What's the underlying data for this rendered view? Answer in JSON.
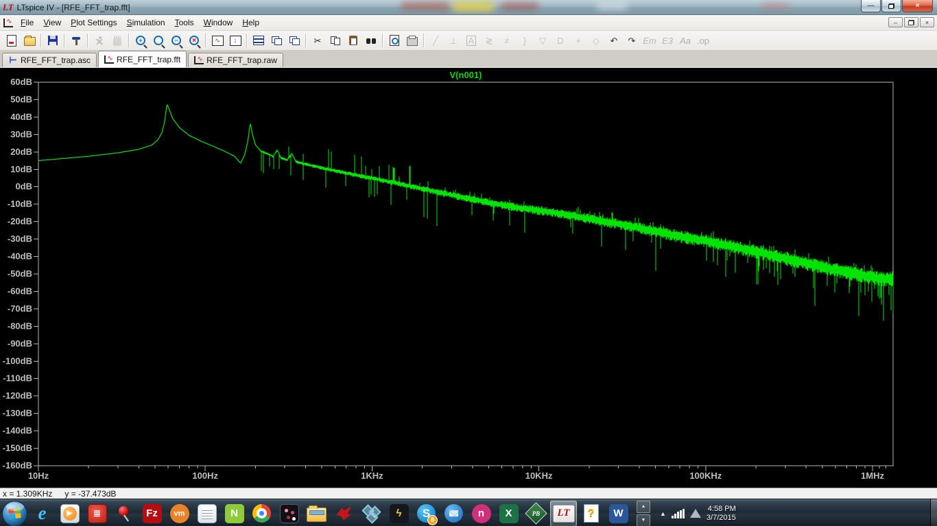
{
  "window": {
    "title": "LTspice IV - [RFE_FFT_trap.fft]",
    "app_icon": "LT",
    "controls": [
      "minimize",
      "restore",
      "close"
    ]
  },
  "menu": {
    "items": [
      "File",
      "View",
      "Plot Settings",
      "Simulation",
      "Tools",
      "Window",
      "Help"
    ],
    "child_controls": [
      "minimize",
      "restore",
      "close"
    ]
  },
  "toolbar": {
    "buttons": [
      {
        "name": "new-schematic-button",
        "icon": "doc",
        "enabled": true
      },
      {
        "name": "open-button",
        "icon": "folder",
        "enabled": true
      },
      {
        "sep": true
      },
      {
        "name": "save-button",
        "icon": "floppy",
        "enabled": true
      },
      {
        "sep": true
      },
      {
        "name": "control-panel-button",
        "icon": "hammer",
        "enabled": true
      },
      {
        "sep": true
      },
      {
        "name": "run-button",
        "icon": "run",
        "enabled": false
      },
      {
        "name": "halt-button",
        "icon": "hand",
        "enabled": false
      },
      {
        "sep": true
      },
      {
        "name": "zoom-in-button",
        "icon": "mag",
        "glyph": "+",
        "enabled": true
      },
      {
        "name": "zoom-window-button",
        "icon": "mag",
        "glyph": "",
        "enabled": true
      },
      {
        "name": "zoom-out-button",
        "icon": "mag",
        "glyph": "−",
        "enabled": true
      },
      {
        "name": "zoom-full-extents-button",
        "icon": "mag",
        "glyph": "×",
        "red": true,
        "enabled": true
      },
      {
        "sep": true
      },
      {
        "name": "autorange-y-button",
        "icon": "wavebox",
        "glyph": "∿",
        "enabled": true
      },
      {
        "name": "pan-zoom-button",
        "icon": "panzoom",
        "glyph": "↕",
        "enabled": true
      },
      {
        "sep": true
      },
      {
        "name": "tile-horizontal-button",
        "icon": "tileh",
        "enabled": true
      },
      {
        "name": "cascade-button",
        "icon": "casc",
        "enabled": true
      },
      {
        "name": "arrange-windows-button",
        "icon": "casc",
        "enabled": true
      },
      {
        "sep": true
      },
      {
        "name": "cut-button",
        "glyph": "✂",
        "color": "#222",
        "enabled": true
      },
      {
        "name": "copy-button",
        "icon": "copy",
        "enabled": true
      },
      {
        "name": "paste-button",
        "icon": "paste",
        "enabled": true
      },
      {
        "name": "find-button",
        "icon": "binoc",
        "enabled": true
      },
      {
        "sep": true
      },
      {
        "name": "print-preview-button",
        "icon": "preview",
        "enabled": true
      },
      {
        "name": "print-button",
        "icon": "printer",
        "enabled": true
      },
      {
        "sep": true
      },
      {
        "name": "draw-wire-button",
        "glyph": "╱",
        "color": "#8a8f94",
        "enabled": false
      },
      {
        "name": "place-ground-button",
        "glyph": "⊥",
        "color": "#8a8f94",
        "enabled": false
      },
      {
        "name": "place-label-button",
        "glyph": "A",
        "boxed": true,
        "color": "#8a8f94",
        "enabled": false
      },
      {
        "name": "place-resistor-button",
        "glyph": "≷",
        "color": "#8a8f94",
        "enabled": false
      },
      {
        "name": "place-capacitor-button",
        "glyph": "≠",
        "color": "#8a8f94",
        "enabled": false
      },
      {
        "name": "place-inductor-button",
        "glyph": "}",
        "color": "#8a8f94",
        "enabled": false
      },
      {
        "name": "place-diode-button",
        "glyph": "▽",
        "color": "#8a8f94",
        "enabled": false
      },
      {
        "name": "place-component-button",
        "glyph": "D",
        "color": "#8a8f94",
        "enabled": false
      },
      {
        "name": "move-button",
        "glyph": "+",
        "color": "#8a8f94",
        "enabled": false
      },
      {
        "name": "drag-button",
        "glyph": "◇",
        "color": "#8a8f94",
        "enabled": false
      },
      {
        "name": "undo-button",
        "glyph": "↶",
        "color": "#333",
        "enabled": true
      },
      {
        "name": "redo-button",
        "glyph": "↷",
        "color": "#333",
        "enabled": true
      },
      {
        "name": "mirror-button",
        "glyph": "Em",
        "italic": true,
        "color": "#777",
        "enabled": false
      },
      {
        "name": "rotate-button",
        "glyph": "E3",
        "italic": true,
        "color": "#777",
        "enabled": false
      },
      {
        "name": "text-button",
        "glyph": "Aa",
        "italic": true,
        "color": "#666",
        "enabled": false
      },
      {
        "name": "spice-directive-button",
        "glyph": ".op",
        "color": "#666",
        "enabled": false
      }
    ]
  },
  "tabs": [
    {
      "label": "RFE_FFT_trap.asc",
      "icon": "schematic",
      "active": false
    },
    {
      "label": "RFE_FFT_trap.fft",
      "icon": "waveform",
      "active": true
    },
    {
      "label": "RFE_FFT_trap.raw",
      "icon": "waveform",
      "active": false
    }
  ],
  "chart_data": {
    "type": "line",
    "title": "V(n001)",
    "x_scale": "log",
    "x_range_hz": [
      10,
      1330000
    ],
    "y_range_db": [
      -160,
      60
    ],
    "grid": false,
    "legend_position": "top-center",
    "trace_color": "#00e400",
    "trace_label_color": "#00dc00",
    "axis_color": "#b8b8b8",
    "background": "#000000",
    "x_ticks": [
      {
        "hz": 10,
        "label": "10Hz"
      },
      {
        "hz": 100,
        "label": "100Hz"
      },
      {
        "hz": 1000,
        "label": "1KHz"
      },
      {
        "hz": 10000,
        "label": "10KHz"
      },
      {
        "hz": 100000,
        "label": "100KHz"
      },
      {
        "hz": 1000000,
        "label": "1MHz"
      }
    ],
    "y_ticks": [
      "60dB",
      "50dB",
      "40dB",
      "30dB",
      "20dB",
      "10dB",
      "0dB",
      "-10dB",
      "-20dB",
      "-30dB",
      "-40dB",
      "-50dB",
      "-60dB",
      "-70dB",
      "-80dB",
      "-90dB",
      "-100dB",
      "-110dB",
      "-120dB",
      "-130dB",
      "-140dB",
      "-150dB",
      "-160dB"
    ],
    "envelope_points": [
      [
        10,
        15
      ],
      [
        20,
        17.5
      ],
      [
        30,
        19.5
      ],
      [
        40,
        21.5
      ],
      [
        48,
        24
      ],
      [
        52,
        27
      ],
      [
        55,
        31
      ],
      [
        57,
        37
      ],
      [
        59,
        47.5
      ],
      [
        61,
        44
      ],
      [
        64,
        39
      ],
      [
        70,
        34
      ],
      [
        80,
        29.5
      ],
      [
        95,
        26
      ],
      [
        110,
        23.5
      ],
      [
        130,
        20.5
      ],
      [
        150,
        17.5
      ],
      [
        163,
        13.5
      ],
      [
        172,
        18
      ],
      [
        180,
        26
      ],
      [
        186,
        36.5
      ],
      [
        192,
        30
      ],
      [
        200,
        24
      ],
      [
        215,
        20.5
      ],
      [
        235,
        19
      ],
      [
        255,
        17.5
      ],
      [
        270,
        21
      ],
      [
        285,
        16.5
      ],
      [
        310,
        15.5
      ],
      [
        330,
        19
      ],
      [
        350,
        14.5
      ],
      [
        380,
        13.5
      ],
      [
        420,
        12.5
      ],
      [
        470,
        11.5
      ],
      [
        520,
        10.5
      ],
      [
        580,
        9.5
      ],
      [
        650,
        8.5
      ],
      [
        730,
        7.5
      ],
      [
        820,
        6.5
      ],
      [
        920,
        5.5
      ],
      [
        1000,
        5
      ],
      [
        1500,
        1.5
      ],
      [
        2200,
        -2
      ],
      [
        3300,
        -5.5
      ],
      [
        5000,
        -9
      ],
      [
        7500,
        -12
      ],
      [
        10000,
        -13.5
      ],
      [
        15000,
        -16
      ],
      [
        22000,
        -19
      ],
      [
        33000,
        -22
      ],
      [
        50000,
        -25.5
      ],
      [
        75000,
        -29
      ],
      [
        100000,
        -31
      ],
      [
        150000,
        -34.5
      ],
      [
        220000,
        -38
      ],
      [
        330000,
        -42
      ],
      [
        500000,
        -46
      ],
      [
        700000,
        -49
      ],
      [
        900000,
        -51
      ],
      [
        1100000,
        -52.5
      ],
      [
        1290000,
        -53
      ]
    ],
    "noise": {
      "seed": 20150307,
      "start_logf": 2.33,
      "description": "noise band widens with frequency, sparse deep downward spikes above 1KHz"
    }
  },
  "status": {
    "x_readout": "x = 1.309KHz",
    "y_readout": "y = -37.473dB"
  },
  "taskbar": {
    "items": [
      {
        "name": "start-button",
        "kind": "orb"
      },
      {
        "name": "internet-explorer-icon",
        "kind": "ie",
        "glyph": "e"
      },
      {
        "name": "media-player-icon",
        "kind": "wmp",
        "glyph": "▶"
      },
      {
        "name": "calibre-icon",
        "kind": "calibre",
        "glyph": "≣"
      },
      {
        "name": "pushpin-icon",
        "kind": "pin"
      },
      {
        "name": "filezilla-icon",
        "kind": "tile",
        "bg": "#b50d12",
        "text": "Fz"
      },
      {
        "name": "vmware-player-icon",
        "kind": "tile circle",
        "bg": "#e8832a",
        "text": "vm",
        "fs": "11"
      },
      {
        "name": "notepad-icon",
        "kind": "notepad"
      },
      {
        "name": "notepad-plus-plus-icon",
        "kind": "tile",
        "bg": "#8eca3a",
        "text": "N",
        "fg": "#fff"
      },
      {
        "name": "chrome-icon",
        "kind": "chrome"
      },
      {
        "name": "dotted-app-icon",
        "kind": "dots"
      },
      {
        "name": "windows-explorer-icon",
        "kind": "folder-big"
      },
      {
        "name": "eagle-icon",
        "kind": "eagle"
      },
      {
        "name": "hexagon-app-icon",
        "kind": "hexes"
      },
      {
        "name": "chip-app-icon",
        "kind": "tile",
        "bg": "#14181c",
        "text": "ϟ",
        "fg": "#ffd23e"
      },
      {
        "name": "skype-icon",
        "kind": "skype",
        "text": "S",
        "badge": "8"
      },
      {
        "name": "thunderbird-icon",
        "kind": "tbird"
      },
      {
        "name": "n-app-icon",
        "kind": "tile circle",
        "bg": "#cf2f7b",
        "text": "n"
      },
      {
        "name": "excel-icon",
        "kind": "tile",
        "bg": "#1c7145",
        "text": "X"
      },
      {
        "name": "powerbasic-icon",
        "kind": "diamond",
        "text": "PB"
      },
      {
        "name": "ltspice-taskbar-button",
        "kind": "ltspice",
        "text": "LT",
        "active": true
      },
      {
        "name": "help-file-icon",
        "kind": "helpdoc",
        "text": "?"
      },
      {
        "name": "word-icon",
        "kind": "tile",
        "bg": "#2b579a",
        "text": "W"
      }
    ],
    "scroller": [
      "▲",
      "▼"
    ],
    "tray": {
      "chevron": "▲",
      "network": "signal-bars",
      "drive": "triangle"
    },
    "clock": {
      "time": "4:58 PM",
      "date": "3/7/2015"
    }
  }
}
